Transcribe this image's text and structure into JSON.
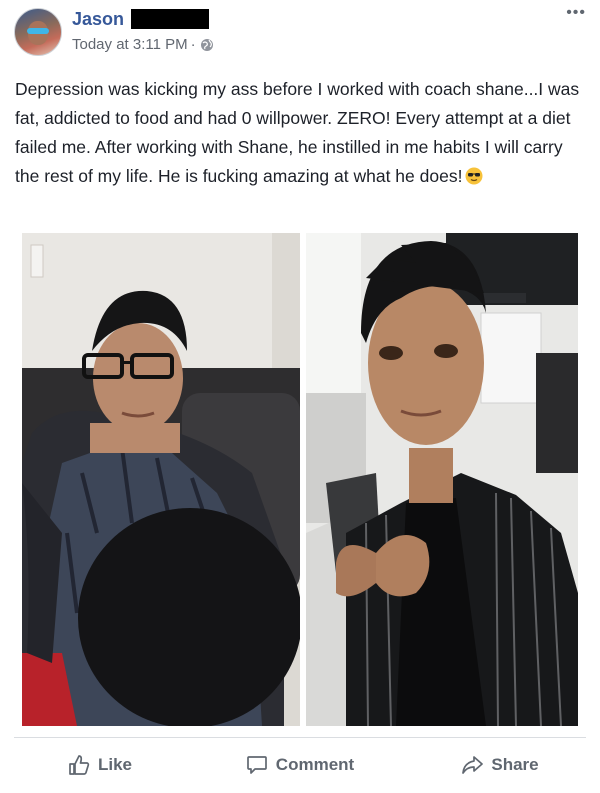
{
  "post": {
    "author": "Jason",
    "timestamp": "Today at 3:11 PM",
    "separator": "·",
    "privacy_icon": "globe-icon",
    "text": "Depression was kicking my ass before I worked with coach shane...I was fat, addicted to food and had 0 willpower. ZERO! Every attempt at a diet failed me. After working with Shane, he instilled in me habits I will carry the rest of my life. He is fucking amazing at what he does!",
    "emoji": "sunglasses-emoji"
  },
  "actions": {
    "like_label": "Like",
    "comment_label": "Comment",
    "share_label": "Share"
  },
  "colors": {
    "author_link": "#365899",
    "meta_text": "#616770",
    "action_text": "#606770"
  }
}
